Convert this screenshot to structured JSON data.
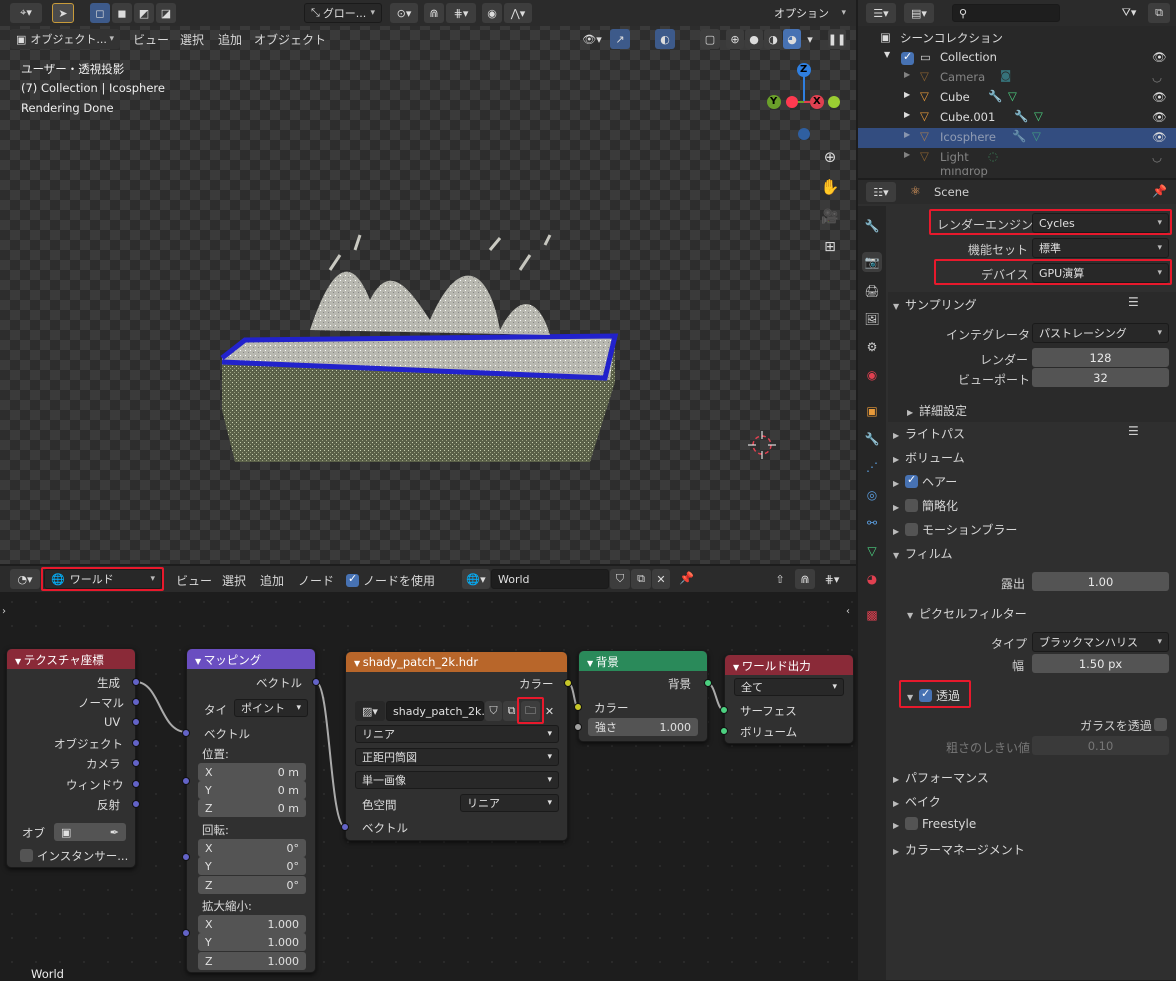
{
  "viewport": {
    "header": {
      "global_label": "グロー...",
      "options_label": "オプション",
      "mode_label": "オブジェクト...",
      "menus": [
        "ビュー",
        "選択",
        "追加",
        "オブジェクト"
      ]
    },
    "overlay": {
      "line1": "ユーザー・透視投影",
      "line2": "(7) Collection | Icosphere",
      "line3": "Rendering Done"
    },
    "gizmo": {
      "z": "Z",
      "y": "Y",
      "x": "X"
    }
  },
  "outliner": {
    "search_placeholder": "",
    "scene_collection_label": "シーンコレクション",
    "items": [
      {
        "name": "Collection",
        "dim": false
      },
      {
        "name": "Camera",
        "dim": true
      },
      {
        "name": "Cube",
        "dim": false
      },
      {
        "name": "Cube.001",
        "dim": false
      },
      {
        "name": "Icosphere",
        "dim": true,
        "selected": true
      },
      {
        "name": "Light",
        "dim": true
      },
      {
        "name": "mindrop",
        "dim": true
      }
    ]
  },
  "properties": {
    "scene_label": "Scene",
    "render_engine": {
      "label": "レンダーエンジン",
      "value": "Cycles"
    },
    "feature_set": {
      "label": "機能セット",
      "value": "標準"
    },
    "device": {
      "label": "デバイス",
      "value": "GPU演算"
    },
    "sampling": {
      "title": "サンプリング",
      "integrator_label": "インテグレータ",
      "integrator_value": "パストレーシング",
      "render_label": "レンダー",
      "render_value": "128",
      "viewport_label": "ビューポート",
      "viewport_value": "32",
      "advanced": "詳細設定"
    },
    "light_paths": "ライトパス",
    "volumes": "ボリューム",
    "hair": "ヘアー",
    "simplify": "簡略化",
    "motion_blur": "モーションブラー",
    "film": {
      "title": "フィルム",
      "exposure_label": "露出",
      "exposure_value": "1.00",
      "pixel_filter": "ピクセルフィルター",
      "type_label": "タイプ",
      "type_value": "ブラックマンハリス",
      "width_label": "幅",
      "width_value": "1.50 px",
      "transparent": "透過",
      "glass_transparent": "ガラスを透過",
      "roughness_label": "粗さのしきい値",
      "roughness_value": "0.10"
    },
    "performance": "パフォーマンス",
    "bake": "ベイク",
    "freestyle": "Freestyle",
    "color_management": "カラーマネージメント"
  },
  "node_editor": {
    "header": {
      "world_type": "ワールド",
      "menus": [
        "ビュー",
        "選択",
        "追加",
        "ノード"
      ],
      "use_nodes": "ノードを使用",
      "world_name": "World"
    },
    "footer_label": "World",
    "tex_coord": {
      "title": "テクスチャ座標",
      "outputs": [
        "生成",
        "ノーマル",
        "UV",
        "オブジェクト",
        "カメラ",
        "ウィンドウ",
        "反射"
      ],
      "object_label": "オブ",
      "instancer": "インスタンサー..."
    },
    "mapping": {
      "title": "マッピング",
      "output": "ベクトル",
      "type_label": "タイ",
      "type_value": "ポイント",
      "vector_input": "ベクトル",
      "location_label": "位置:",
      "location": [
        {
          "axis": "X",
          "value": "0 m"
        },
        {
          "axis": "Y",
          "value": "0 m"
        },
        {
          "axis": "Z",
          "value": "0 m"
        }
      ],
      "rotation_label": "回転:",
      "rotation": [
        {
          "axis": "X",
          "value": "0°"
        },
        {
          "axis": "Y",
          "value": "0°"
        },
        {
          "axis": "Z",
          "value": "0°"
        }
      ],
      "scale_label": "拡大縮小:",
      "scale": [
        {
          "axis": "X",
          "value": "1.000"
        },
        {
          "axis": "Y",
          "value": "1.000"
        },
        {
          "axis": "Z",
          "value": "1.000"
        }
      ]
    },
    "env_tex": {
      "title": "shady_patch_2k.hdr",
      "output": "カラー",
      "image_name": "shady_patch_2k...",
      "interpolation": "リニア",
      "projection": "正距円筒図",
      "source": "単一画像",
      "colorspace_label": "色空間",
      "colorspace_value": "リニア",
      "vector_input": "ベクトル"
    },
    "background": {
      "title": "背景",
      "output": "背景",
      "color_input": "カラー",
      "strength_label": "強さ",
      "strength_value": "1.000"
    },
    "world_output": {
      "title": "ワールド出力",
      "target": "全て",
      "surface": "サーフェス",
      "volume": "ボリューム"
    }
  },
  "colors": {
    "accent_blue": "#4772b3",
    "highlight_red": "#e8192c",
    "tex_coord_header": "#8a2a38",
    "mapping_header": "#6a4ec0",
    "env_tex_header": "#b8662a",
    "background_header": "#2a8a5a",
    "output_header": "#8a2a38"
  }
}
